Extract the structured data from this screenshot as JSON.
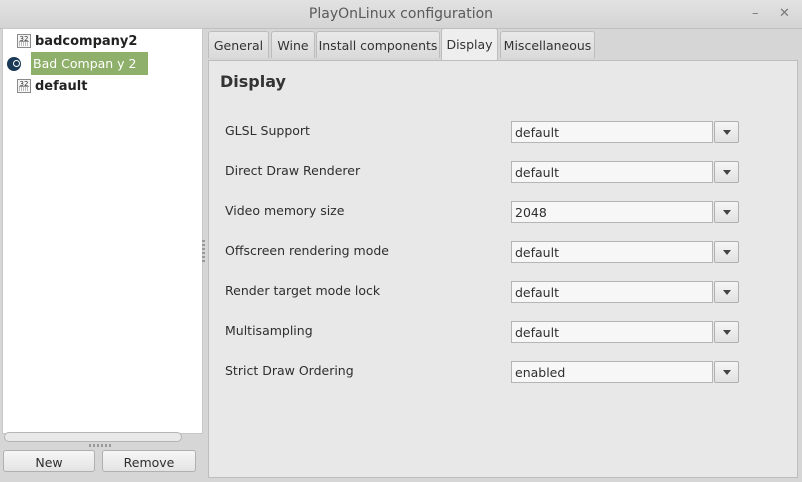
{
  "window": {
    "title": "PlayOnLinux configuration",
    "minimize_glyph": "–",
    "close_glyph": "✕"
  },
  "tree": {
    "items": [
      {
        "label": "badcompany2",
        "badge": "32",
        "icon": "wine-32bit-prefix-icon"
      },
      {
        "label": "Bad Compan y 2",
        "icon": "steam-icon",
        "selected": true
      },
      {
        "label": "default",
        "badge": "32",
        "icon": "wine-32bit-prefix-icon"
      }
    ],
    "selected_color": "#8fb06a"
  },
  "buttons": {
    "new": "New",
    "remove": "Remove"
  },
  "tabs": [
    "General",
    "Wine",
    "Install components",
    "Display",
    "Miscellaneous"
  ],
  "active_tab": "Display",
  "display": {
    "heading": "Display",
    "settings": [
      {
        "label": "GLSL Support",
        "value": "default"
      },
      {
        "label": "Direct Draw Renderer",
        "value": "default"
      },
      {
        "label": "Video memory size",
        "value": "2048"
      },
      {
        "label": "Offscreen rendering mode",
        "value": "default"
      },
      {
        "label": "Render target mode lock",
        "value": "default"
      },
      {
        "label": "Multisampling",
        "value": "default"
      },
      {
        "label": "Strict Draw Ordering",
        "value": "enabled"
      }
    ]
  }
}
